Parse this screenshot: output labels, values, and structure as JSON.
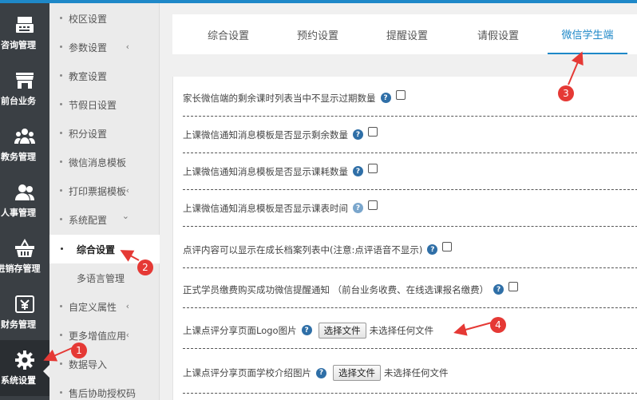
{
  "rail": {
    "items": [
      {
        "label": "咨询管理",
        "icon": "register-icon"
      },
      {
        "label": "前台业务",
        "icon": "store-icon"
      },
      {
        "label": "教务管理",
        "icon": "group-icon"
      },
      {
        "label": "人事管理",
        "icon": "people-icon"
      },
      {
        "label": "进销存管理",
        "icon": "basket-icon"
      },
      {
        "label": "财务管理",
        "icon": "finance-icon"
      },
      {
        "label": "系统设置",
        "icon": "gear-icon"
      }
    ]
  },
  "submenu": {
    "items": [
      {
        "label": "校区设置"
      },
      {
        "label": "参数设置"
      },
      {
        "label": "教室设置"
      },
      {
        "label": "节假日设置"
      },
      {
        "label": "积分设置"
      },
      {
        "label": "微信消息模板"
      },
      {
        "label": "打印票据模板"
      },
      {
        "label": "系统配置"
      },
      {
        "label": "综合设置"
      },
      {
        "label": "多语言管理"
      },
      {
        "label": "自定义属性"
      },
      {
        "label": "更多增值应用"
      },
      {
        "label": "数据导入"
      },
      {
        "label": "售后协助授权码"
      }
    ],
    "arrow_left": "‹",
    "arrow_down": "⌄"
  },
  "tabs": [
    {
      "label": "综合设置"
    },
    {
      "label": "预约设置"
    },
    {
      "label": "提醒设置"
    },
    {
      "label": "请假设置"
    },
    {
      "label": "微信学生端"
    }
  ],
  "settings": {
    "rows": [
      {
        "label": "家长微信端的剩余课时列表当中不显示过期数量"
      },
      {
        "label": "上课微信通知消息模板是否显示剩余数量"
      },
      {
        "label": "上课微信通知消息模板是否显示课耗数量"
      },
      {
        "label": "上课微信通知消息模板是否显示课表时间"
      },
      {
        "label": "点评内容可以显示在成长档案列表中(注意:点评语音不显示)"
      },
      {
        "label": "正式学员缴费购买成功微信提醒通知 （前台业务收费、在线选课报名缴费）"
      },
      {
        "label": "上课点评分享页面Logo图片"
      },
      {
        "label": "上课点评分享页面学校介绍图片"
      }
    ],
    "help_glyph": "?",
    "file_button": "选择文件",
    "file_none": "未选择任何文件"
  },
  "annotations": [
    "1",
    "2",
    "3",
    "4"
  ],
  "colors": {
    "accent": "#1e88c8",
    "rail": "#3a3f44",
    "annotation": "#e53935"
  }
}
